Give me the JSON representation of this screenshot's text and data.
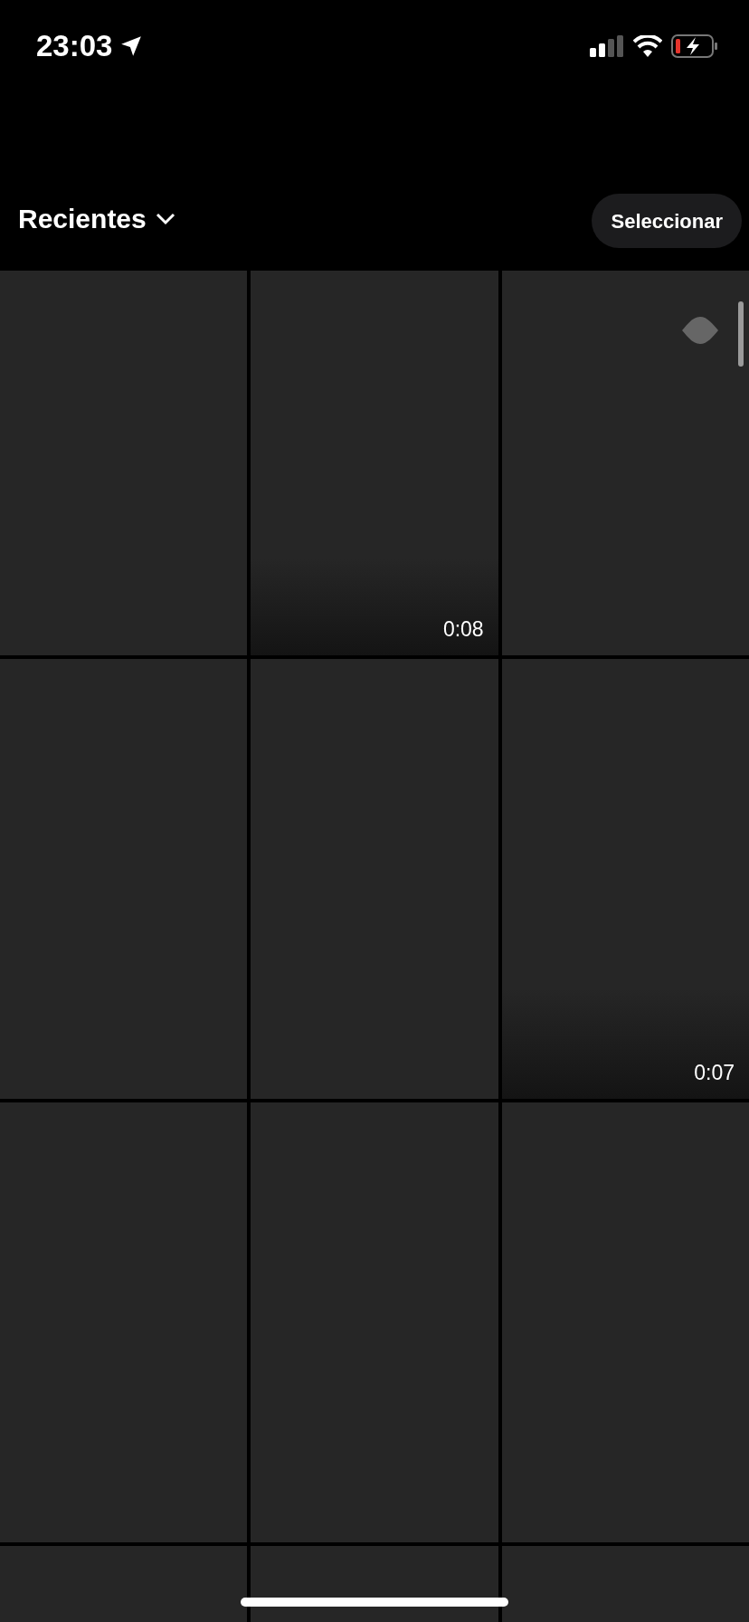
{
  "status_bar": {
    "time": "23:03"
  },
  "header": {
    "album": "Recientes",
    "select_button": "Seleccionar"
  },
  "tiles": [
    {
      "kind": "photo",
      "badge": false
    },
    {
      "kind": "video",
      "duration": "0:08",
      "badge": false
    },
    {
      "kind": "photo",
      "badge": true
    },
    {
      "kind": "photo",
      "badge": false
    },
    {
      "kind": "photo",
      "badge": false
    },
    {
      "kind": "video",
      "duration": "0:07",
      "badge": false
    },
    {
      "kind": "photo",
      "badge": false
    },
    {
      "kind": "photo",
      "badge": false
    },
    {
      "kind": "photo",
      "badge": false
    },
    {
      "kind": "photo",
      "badge": false
    },
    {
      "kind": "photo",
      "badge": false
    },
    {
      "kind": "photo",
      "badge": false
    }
  ]
}
